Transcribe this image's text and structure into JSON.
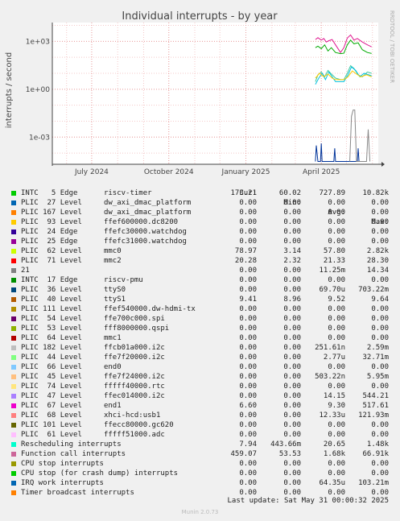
{
  "chart_data": {
    "type": "line",
    "title": "Individual interrupts - by year",
    "ylabel": "interrupts / second",
    "yscale": "log",
    "ylim": [
      2e-05,
      15000
    ],
    "y_ticks": [
      {
        "v": 1000,
        "label": "1e+03"
      },
      {
        "v": 1,
        "label": "1e+00"
      },
      {
        "v": 0.001,
        "label": "1e-03"
      }
    ],
    "x_range": [
      "2024-05-15",
      "2025-06-08"
    ],
    "x_ticks": [
      {
        "date": "2024-07-01",
        "label": "July 2024"
      },
      {
        "date": "2024-10-01",
        "label": "October 2024"
      },
      {
        "date": "2025-01-01",
        "label": "January 2025"
      },
      {
        "date": "2025-04-01",
        "label": "April 2025"
      }
    ],
    "grid": true,
    "series": [
      {
        "color": "#e01890",
        "points": [
          [
            "2025-03-25",
            1300
          ],
          [
            "2025-03-28",
            1700
          ],
          [
            "2025-04-01",
            1200
          ],
          [
            "2025-04-04",
            1500
          ],
          [
            "2025-04-07",
            900
          ],
          [
            "2025-04-10",
            1100
          ],
          [
            "2025-04-14",
            1300
          ],
          [
            "2025-04-18",
            600
          ],
          [
            "2025-04-24",
            200
          ],
          [
            "2025-04-28",
            400
          ],
          [
            "2025-05-02",
            1600
          ],
          [
            "2025-05-06",
            2500
          ],
          [
            "2025-05-10",
            1200
          ],
          [
            "2025-05-14",
            1500
          ],
          [
            "2025-05-20",
            900
          ],
          [
            "2025-05-26",
            600
          ],
          [
            "2025-05-31",
            450
          ]
        ]
      },
      {
        "color": "#00aa00",
        "points": [
          [
            "2025-03-25",
            400
          ],
          [
            "2025-03-28",
            500
          ],
          [
            "2025-04-01",
            350
          ],
          [
            "2025-04-05",
            600
          ],
          [
            "2025-04-09",
            250
          ],
          [
            "2025-04-13",
            400
          ],
          [
            "2025-04-18",
            200
          ],
          [
            "2025-04-24",
            170
          ],
          [
            "2025-04-28",
            180
          ],
          [
            "2025-05-02",
            600
          ],
          [
            "2025-05-06",
            1200
          ],
          [
            "2025-05-10",
            700
          ],
          [
            "2025-05-15",
            800
          ],
          [
            "2025-05-20",
            300
          ],
          [
            "2025-05-26",
            200
          ],
          [
            "2025-05-31",
            173
          ]
        ]
      },
      {
        "color": "#40c8a0",
        "points": [
          [
            "2025-03-25",
            3
          ],
          [
            "2025-03-28",
            8
          ],
          [
            "2025-04-01",
            12
          ],
          [
            "2025-04-05",
            6
          ],
          [
            "2025-04-09",
            15
          ],
          [
            "2025-04-13",
            9
          ],
          [
            "2025-04-18",
            5
          ],
          [
            "2025-04-24",
            4
          ],
          [
            "2025-04-28",
            4
          ],
          [
            "2025-05-02",
            10
          ],
          [
            "2025-05-06",
            30
          ],
          [
            "2025-05-10",
            20
          ],
          [
            "2025-05-15",
            8
          ],
          [
            "2025-05-20",
            6
          ],
          [
            "2025-05-26",
            12
          ],
          [
            "2025-05-31",
            10
          ]
        ]
      },
      {
        "color": "#00c0e0",
        "points": [
          [
            "2025-03-25",
            2
          ],
          [
            "2025-03-29",
            5
          ],
          [
            "2025-04-02",
            10
          ],
          [
            "2025-04-06",
            4
          ],
          [
            "2025-04-10",
            12
          ],
          [
            "2025-04-14",
            6
          ],
          [
            "2025-04-18",
            3
          ],
          [
            "2025-04-28",
            3
          ],
          [
            "2025-05-03",
            8
          ],
          [
            "2025-05-07",
            25
          ],
          [
            "2025-05-12",
            15
          ],
          [
            "2025-05-17",
            6
          ],
          [
            "2025-05-22",
            10
          ],
          [
            "2025-05-31",
            7
          ]
        ]
      },
      {
        "color": "#ffcc00",
        "points": [
          [
            "2025-03-25",
            5
          ],
          [
            "2025-03-30",
            10
          ],
          [
            "2025-04-04",
            6
          ],
          [
            "2025-04-09",
            9
          ],
          [
            "2025-04-14",
            5
          ],
          [
            "2025-04-18",
            4
          ],
          [
            "2025-04-28",
            4
          ],
          [
            "2025-05-03",
            6
          ],
          [
            "2025-05-08",
            14
          ],
          [
            "2025-05-13",
            9
          ],
          [
            "2025-05-18",
            6
          ],
          [
            "2025-05-25",
            8
          ],
          [
            "2025-05-31",
            6
          ]
        ]
      },
      {
        "color": "#003399",
        "points": [
          [
            "2025-03-25",
            3e-05
          ],
          [
            "2025-03-26",
            0.0003
          ],
          [
            "2025-03-28",
            3e-05
          ],
          [
            "2025-03-31",
            3e-05
          ],
          [
            "2025-04-01",
            0.0004
          ],
          [
            "2025-04-02",
            3e-05
          ],
          [
            "2025-04-16",
            3e-05
          ],
          [
            "2025-04-17",
            0.0002
          ],
          [
            "2025-04-18",
            3e-05
          ],
          [
            "2025-05-14",
            3e-05
          ],
          [
            "2025-05-15",
            0.0002
          ],
          [
            "2025-05-16",
            3e-05
          ]
        ]
      },
      {
        "color": "#888888",
        "points": [
          [
            "2025-05-05",
            3e-05
          ],
          [
            "2025-05-07",
            0.02
          ],
          [
            "2025-05-09",
            0.05
          ],
          [
            "2025-05-11",
            0.05
          ],
          [
            "2025-05-13",
            3e-05
          ],
          [
            "2025-05-25",
            3e-05
          ],
          [
            "2025-05-27",
            0.003
          ],
          [
            "2025-05-29",
            3e-05
          ]
        ]
      }
    ]
  },
  "side_text": "RRDTOOL / TOBI OETIKER",
  "legend": {
    "headers": [
      "Cur:",
      "Min:",
      "Avg:",
      "Max:"
    ],
    "rows": [
      {
        "name": "INTC   5 Edge      riscv-timer",
        "color": "#00cc00",
        "cur": "173.21",
        "min": "60.02",
        "avg": "727.89",
        "max": "10.82k"
      },
      {
        "name": "PLIC  27 Level     dw_axi_dmac_platform",
        "color": "#0066b3",
        "cur": "0.00",
        "min": "0.00",
        "avg": "0.00",
        "max": "0.00"
      },
      {
        "name": "PLIC 167 Level     dw_axi_dmac_platform",
        "color": "#ff8000",
        "cur": "0.00",
        "min": "0.00",
        "avg": "0.00",
        "max": "0.00"
      },
      {
        "name": "PLIC  93 Level     ffef600000.dc8200",
        "color": "#ffcc00",
        "cur": "0.00",
        "min": "0.00",
        "avg": "0.00",
        "max": "0.00"
      },
      {
        "name": "PLIC  24 Edge      ffefc30000.watchdog",
        "color": "#330099",
        "cur": "0.00",
        "min": "0.00",
        "avg": "0.00",
        "max": "0.00"
      },
      {
        "name": "PLIC  25 Edge      ffefc31000.watchdog",
        "color": "#990099",
        "cur": "0.00",
        "min": "0.00",
        "avg": "0.00",
        "max": "0.00"
      },
      {
        "name": "PLIC  62 Level     mmc0",
        "color": "#ccff00",
        "cur": "78.97",
        "min": "3.14",
        "avg": "57.80",
        "max": "2.82k"
      },
      {
        "name": "PLIC  71 Level     mmc2",
        "color": "#ff0000",
        "cur": "20.28",
        "min": "2.32",
        "avg": "21.33",
        "max": "28.30"
      },
      {
        "name": "21",
        "color": "#808080",
        "cur": "0.00",
        "min": "0.00",
        "avg": "11.25m",
        "max": "14.34"
      },
      {
        "name": "INTC  17 Edge      riscv-pmu",
        "color": "#008f00",
        "cur": "0.00",
        "min": "0.00",
        "avg": "0.00",
        "max": "0.00"
      },
      {
        "name": "PLIC  36 Level     ttyS0",
        "color": "#00487d",
        "cur": "0.00",
        "min": "0.00",
        "avg": "69.70u",
        "max": "703.22m"
      },
      {
        "name": "PLIC  40 Level     ttyS1",
        "color": "#b35a00",
        "cur": "9.41",
        "min": "8.96",
        "avg": "9.52",
        "max": "9.64"
      },
      {
        "name": "PLIC 111 Level     ffef540000.dw-hdmi-tx",
        "color": "#b38f00",
        "cur": "0.00",
        "min": "0.00",
        "avg": "0.00",
        "max": "0.00"
      },
      {
        "name": "PLIC  54 Level     ffe700c000.spi",
        "color": "#6b006b",
        "cur": "0.00",
        "min": "0.00",
        "avg": "0.00",
        "max": "0.00"
      },
      {
        "name": "PLIC  53 Level     fff8000000.qspi",
        "color": "#8fb300",
        "cur": "0.00",
        "min": "0.00",
        "avg": "0.00",
        "max": "0.00"
      },
      {
        "name": "PLIC  64 Level     mmc1",
        "color": "#b30000",
        "cur": "0.00",
        "min": "0.00",
        "avg": "0.00",
        "max": "0.00"
      },
      {
        "name": "PLIC 182 Level     ffcb01a000.i2c",
        "color": "#bebebe",
        "cur": "0.00",
        "min": "0.00",
        "avg": "251.61n",
        "max": "2.59m"
      },
      {
        "name": "PLIC  44 Level     ffe7f20000.i2c",
        "color": "#80ff80",
        "cur": "0.00",
        "min": "0.00",
        "avg": "2.77u",
        "max": "32.71m"
      },
      {
        "name": "PLIC  66 Level     end0",
        "color": "#80c9ff",
        "cur": "0.00",
        "min": "0.00",
        "avg": "0.00",
        "max": "0.00"
      },
      {
        "name": "PLIC  45 Level     ffe7f24000.i2c",
        "color": "#ffc080",
        "cur": "0.00",
        "min": "0.00",
        "avg": "503.22n",
        "max": "5.95m"
      },
      {
        "name": "PLIC  74 Level     fffff40000.rtc",
        "color": "#ffe680",
        "cur": "0.00",
        "min": "0.00",
        "avg": "0.00",
        "max": "0.00"
      },
      {
        "name": "PLIC  47 Level     ffec014000.i2c",
        "color": "#aa80ff",
        "cur": "0.00",
        "min": "0.00",
        "avg": "14.15",
        "max": "544.21"
      },
      {
        "name": "PLIC  67 Level     end1",
        "color": "#ee00cc",
        "cur": "6.60",
        "min": "0.00",
        "avg": "9.30",
        "max": "517.61"
      },
      {
        "name": "PLIC  68 Level     xhci-hcd:usb1",
        "color": "#ff8080",
        "cur": "0.00",
        "min": "0.00",
        "avg": "12.33u",
        "max": "121.93m"
      },
      {
        "name": "PLIC 101 Level     ffecc80000.gc620",
        "color": "#666600",
        "cur": "0.00",
        "min": "0.00",
        "avg": "0.00",
        "max": "0.00"
      },
      {
        "name": "PLIC  61 Level     fffff51000.adc",
        "color": "#ffbfff",
        "cur": "0.00",
        "min": "0.00",
        "avg": "0.00",
        "max": "0.00"
      },
      {
        "name": "Rescheduling interrupts",
        "color": "#00ffcc",
        "cur": "7.94",
        "min": "443.66m",
        "avg": "20.65",
        "max": "1.48k"
      },
      {
        "name": "Function call interrupts",
        "color": "#cc6699",
        "cur": "459.07",
        "min": "53.53",
        "avg": "1.68k",
        "max": "66.91k"
      },
      {
        "name": "CPU stop interrupts",
        "color": "#999900",
        "cur": "0.00",
        "min": "0.00",
        "avg": "0.00",
        "max": "0.00"
      },
      {
        "name": "CPU stop (for crash dump) interrupts",
        "color": "#00cc00",
        "cur": "0.00",
        "min": "0.00",
        "avg": "0.00",
        "max": "0.00"
      },
      {
        "name": "IRQ work interrupts",
        "color": "#0066b3",
        "cur": "0.00",
        "min": "0.00",
        "avg": "64.35u",
        "max": "103.21m"
      },
      {
        "name": "Timer broadcast interrupts",
        "color": "#ff8000",
        "cur": "0.00",
        "min": "0.00",
        "avg": "0.00",
        "max": "0.00"
      }
    ]
  },
  "last_update": "Last update: Sat May 31 00:00:32 2025",
  "footer": "Munin 2.0.73"
}
